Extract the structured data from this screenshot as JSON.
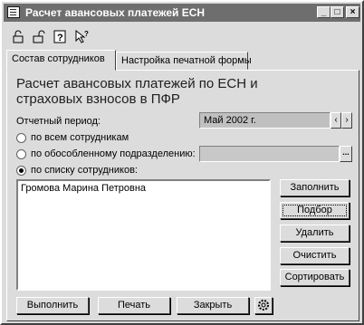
{
  "window": {
    "title": "Расчет авансовых платежей ЕСН"
  },
  "tabs": [
    {
      "label": "Состав сотрудников"
    },
    {
      "label": "Настройка печатной формы"
    }
  ],
  "heading": "Расчет авансовых платежей по ЕСН и страховых взносов в ПФР",
  "period": {
    "label": "Отчетный период:",
    "value": "Май 2002 г."
  },
  "radios": [
    {
      "label": "по всем сотрудникам",
      "selected": false
    },
    {
      "label": "по обособленному подразделению:",
      "selected": false
    },
    {
      "label": "по списку сотрудников:",
      "selected": true
    }
  ],
  "employees": [
    "Громова Марина Петровна"
  ],
  "side_buttons": {
    "fill": "Заполнить",
    "select": "Подбор",
    "delete": "Удалить",
    "clear": "Очистить",
    "sort": "Сортировать"
  },
  "bottom_buttons": {
    "run": "Выполнить",
    "print": "Печать",
    "close": "Закрыть"
  },
  "colors": {
    "titlebar": "#6e6e6e",
    "window_bg": "#dcdcdc",
    "period_bg": "#c0c0c0"
  }
}
